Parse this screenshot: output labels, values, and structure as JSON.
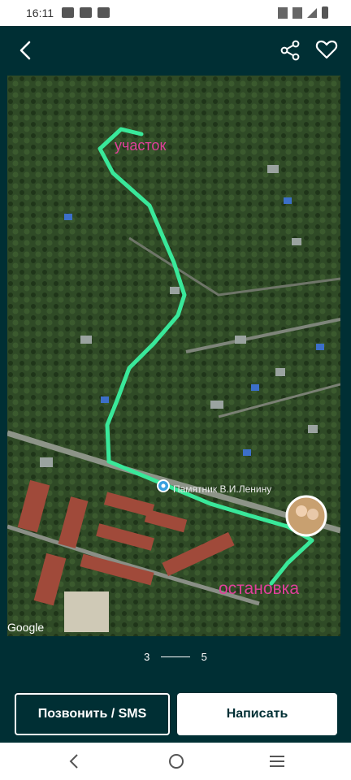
{
  "status": {
    "time": "16:11",
    "left_icons": [
      "image-icon",
      "youtube-icon",
      "cast-icon"
    ],
    "right_icons": [
      "mute-icon",
      "wifi-icon",
      "signal-icon",
      "battery-icon"
    ]
  },
  "header": {
    "back_icon": "chevron-left-icon",
    "share_icon": "share-icon",
    "favorite_icon": "heart-icon"
  },
  "photo": {
    "label_top": "участок",
    "label_monument": "Памятник В.И.Ленину",
    "label_bottom": "остановка",
    "watermark": "Google",
    "route_color": "#39e89a",
    "label_color": "#e0409a"
  },
  "pager": {
    "current": "3",
    "total": "5"
  },
  "buttons": {
    "call_label": "Позвонить / SMS",
    "write_label": "Написать"
  },
  "navbar": {
    "icons": [
      "back-icon",
      "home-icon",
      "recents-icon"
    ]
  },
  "colors": {
    "background": "#002f34",
    "accent_text": "#ffffff"
  }
}
